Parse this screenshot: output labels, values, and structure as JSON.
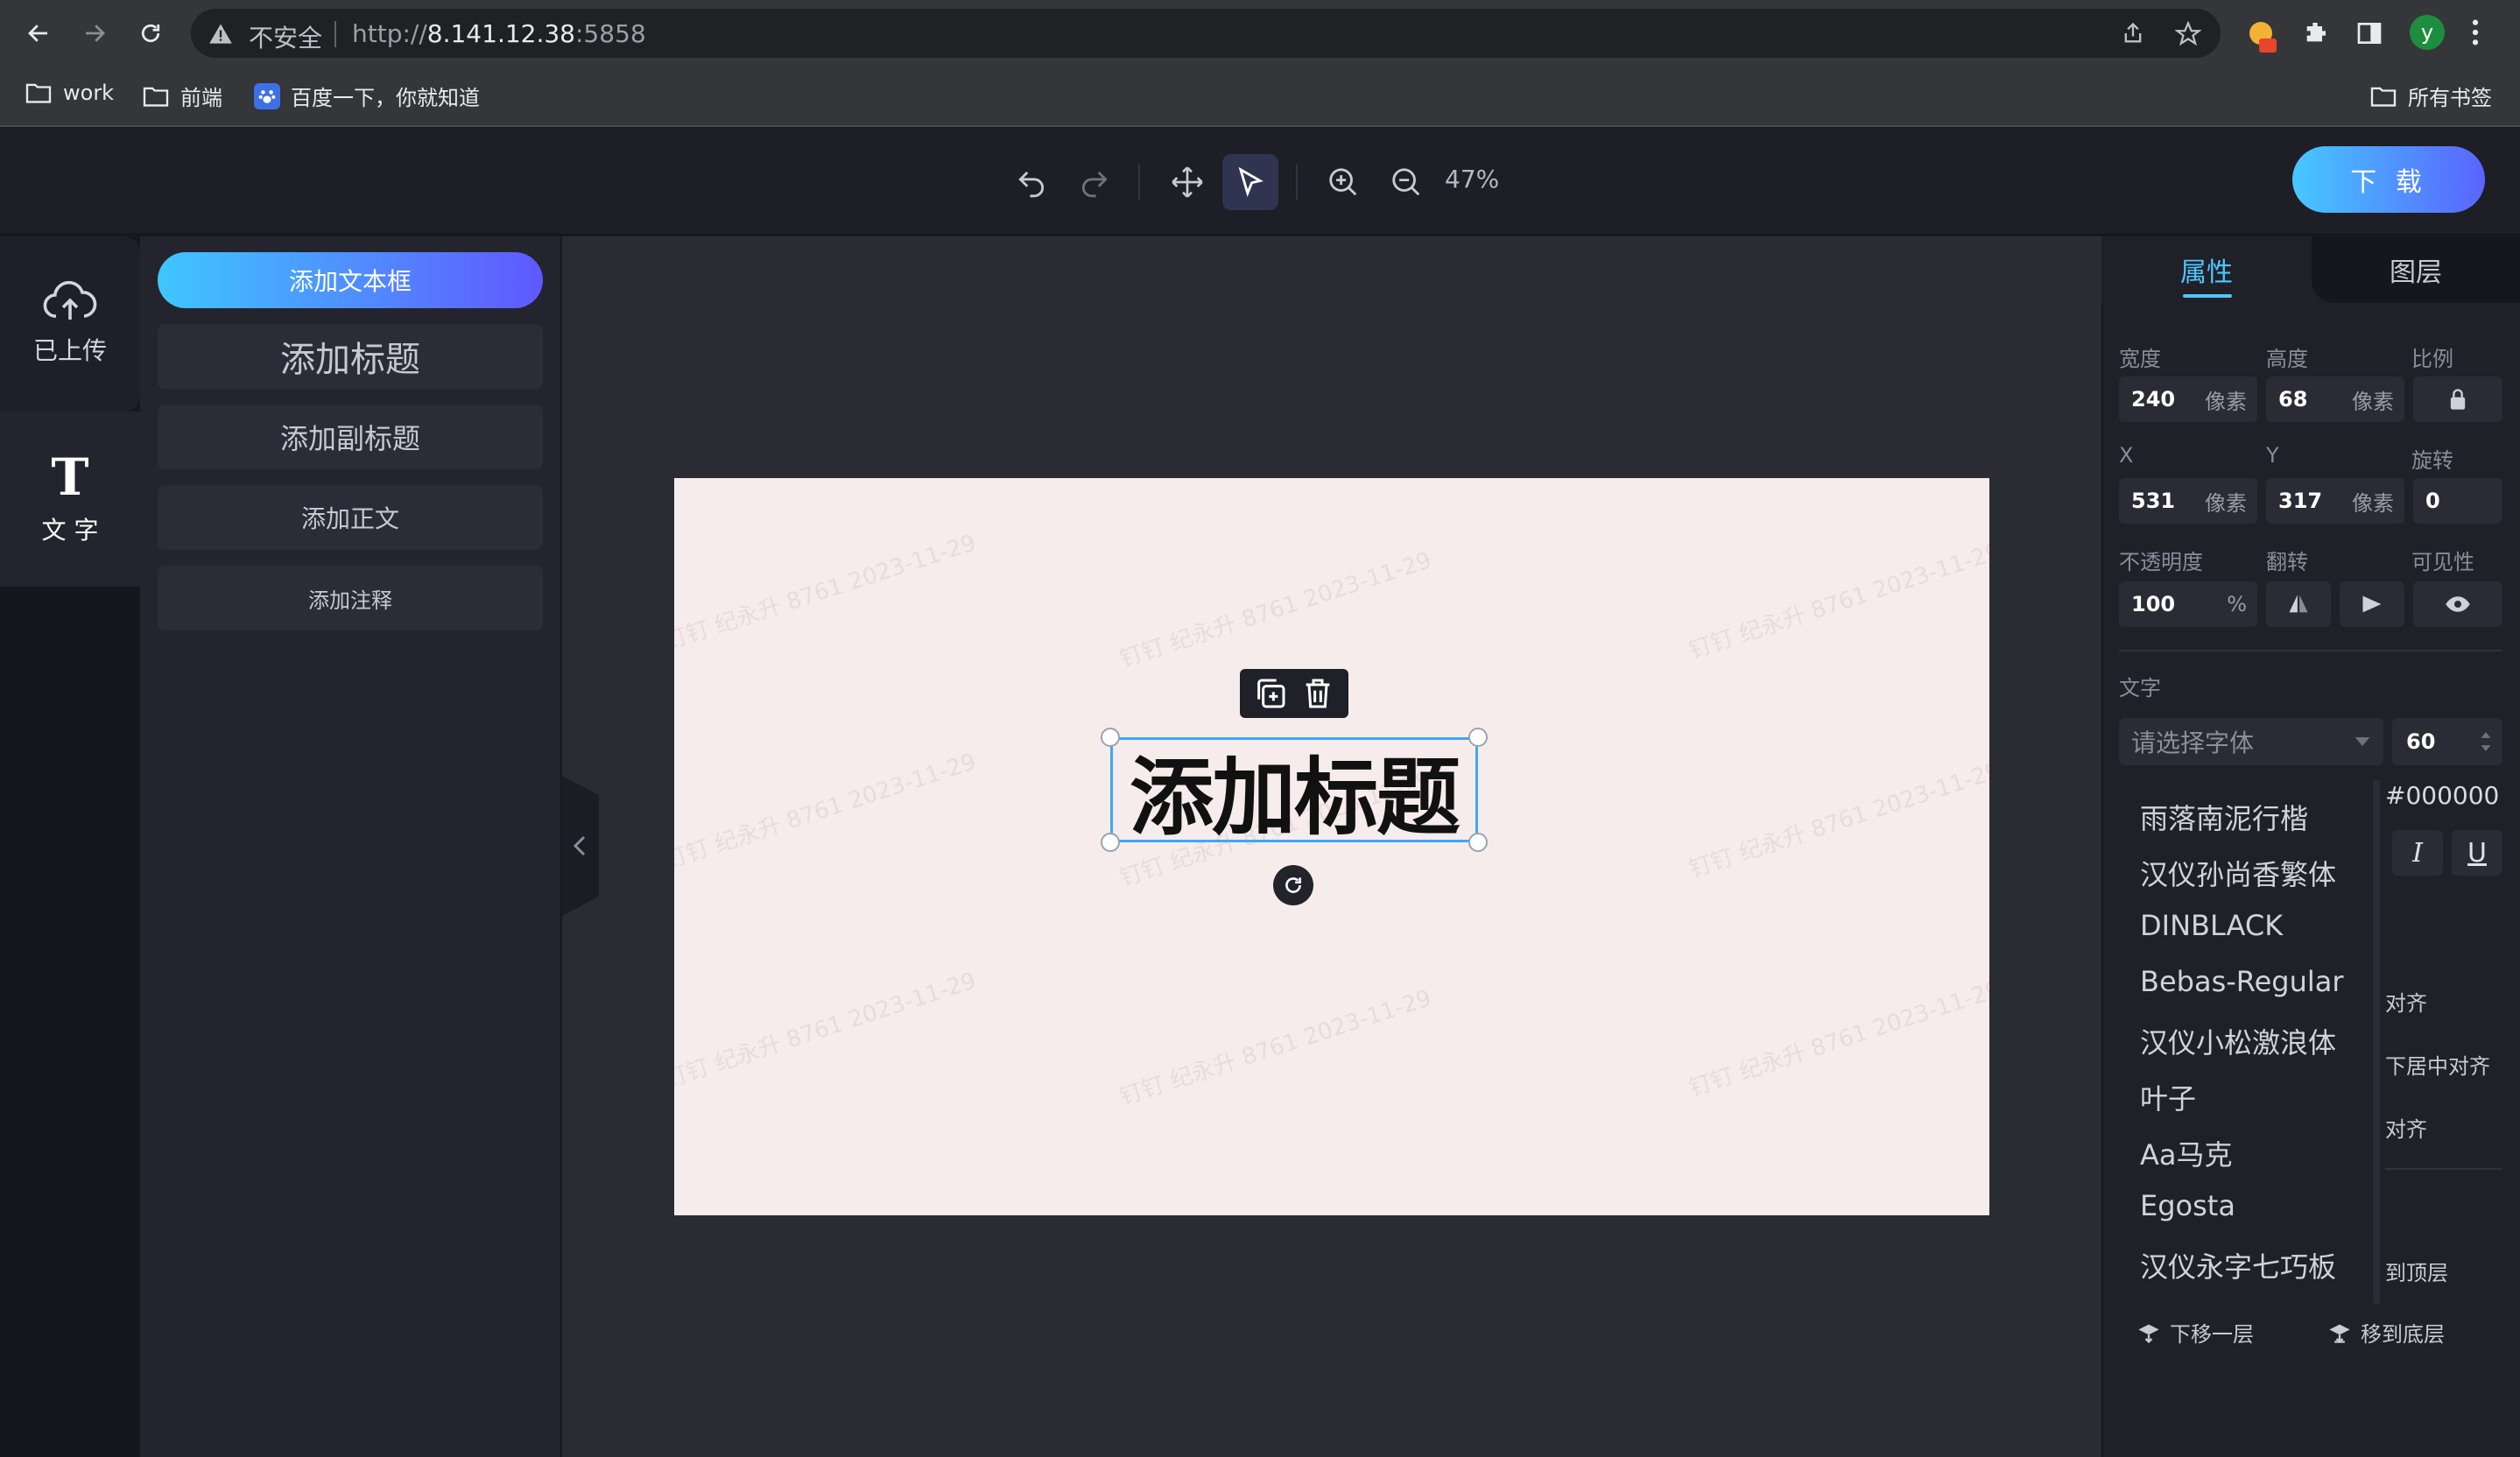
{
  "browser": {
    "insecure_label": "不安全",
    "url_scheme": "http://",
    "url_host": "8.141.12.38",
    "url_port": ":5858",
    "profile_initial": "y",
    "bookmarks": [
      "work",
      "前端",
      "百度一下，你就知道"
    ],
    "all_bookmarks": "所有书签"
  },
  "header": {
    "zoom": "47%",
    "download_label": "下 载"
  },
  "rail": {
    "upload_label": "已上传",
    "text_icon": "T",
    "text_label": "文 字"
  },
  "panel": {
    "add_textbox": "添加文本框",
    "add_title": "添加标题",
    "add_subtitle": "添加副标题",
    "add_body": "添加正文",
    "add_note": "添加注释"
  },
  "canvas": {
    "selected_text": "添加标题",
    "watermark": "钉钉 纪永升 8761 2023-11-29"
  },
  "props": {
    "tab_props": "属性",
    "tab_layers": "图层",
    "width_label": "宽度",
    "height_label": "高度",
    "ratio_label": "比例",
    "width": "240",
    "height": "68",
    "unit_px": "像素",
    "x_label": "X",
    "y_label": "Y",
    "rotate_label": "旋转",
    "x": "531",
    "y": "317",
    "rotate": "0",
    "opacity_label": "不透明度",
    "flip_label": "翻转",
    "visibility_label": "可见性",
    "opacity": "100",
    "percent": "%",
    "text_section": "文字",
    "font_placeholder": "请选择字体",
    "font_size": "60",
    "color": "#000000",
    "italic": "I",
    "underline": "U",
    "partial_align_1": "对齐",
    "partial_align_2": "下居中对齐",
    "partial_align_3": "对齐",
    "partial_top": "到顶层",
    "move_down": "下移一层",
    "move_bottom": "移到底层"
  },
  "font_options": [
    "雨落南泥行楷",
    "汉仪孙尚香繁体",
    "DINBLACK",
    "Bebas-Regular",
    "汉仪小松激浪体",
    "叶子",
    "Aa马克",
    "Egosta",
    "汉仪永字七巧板"
  ]
}
